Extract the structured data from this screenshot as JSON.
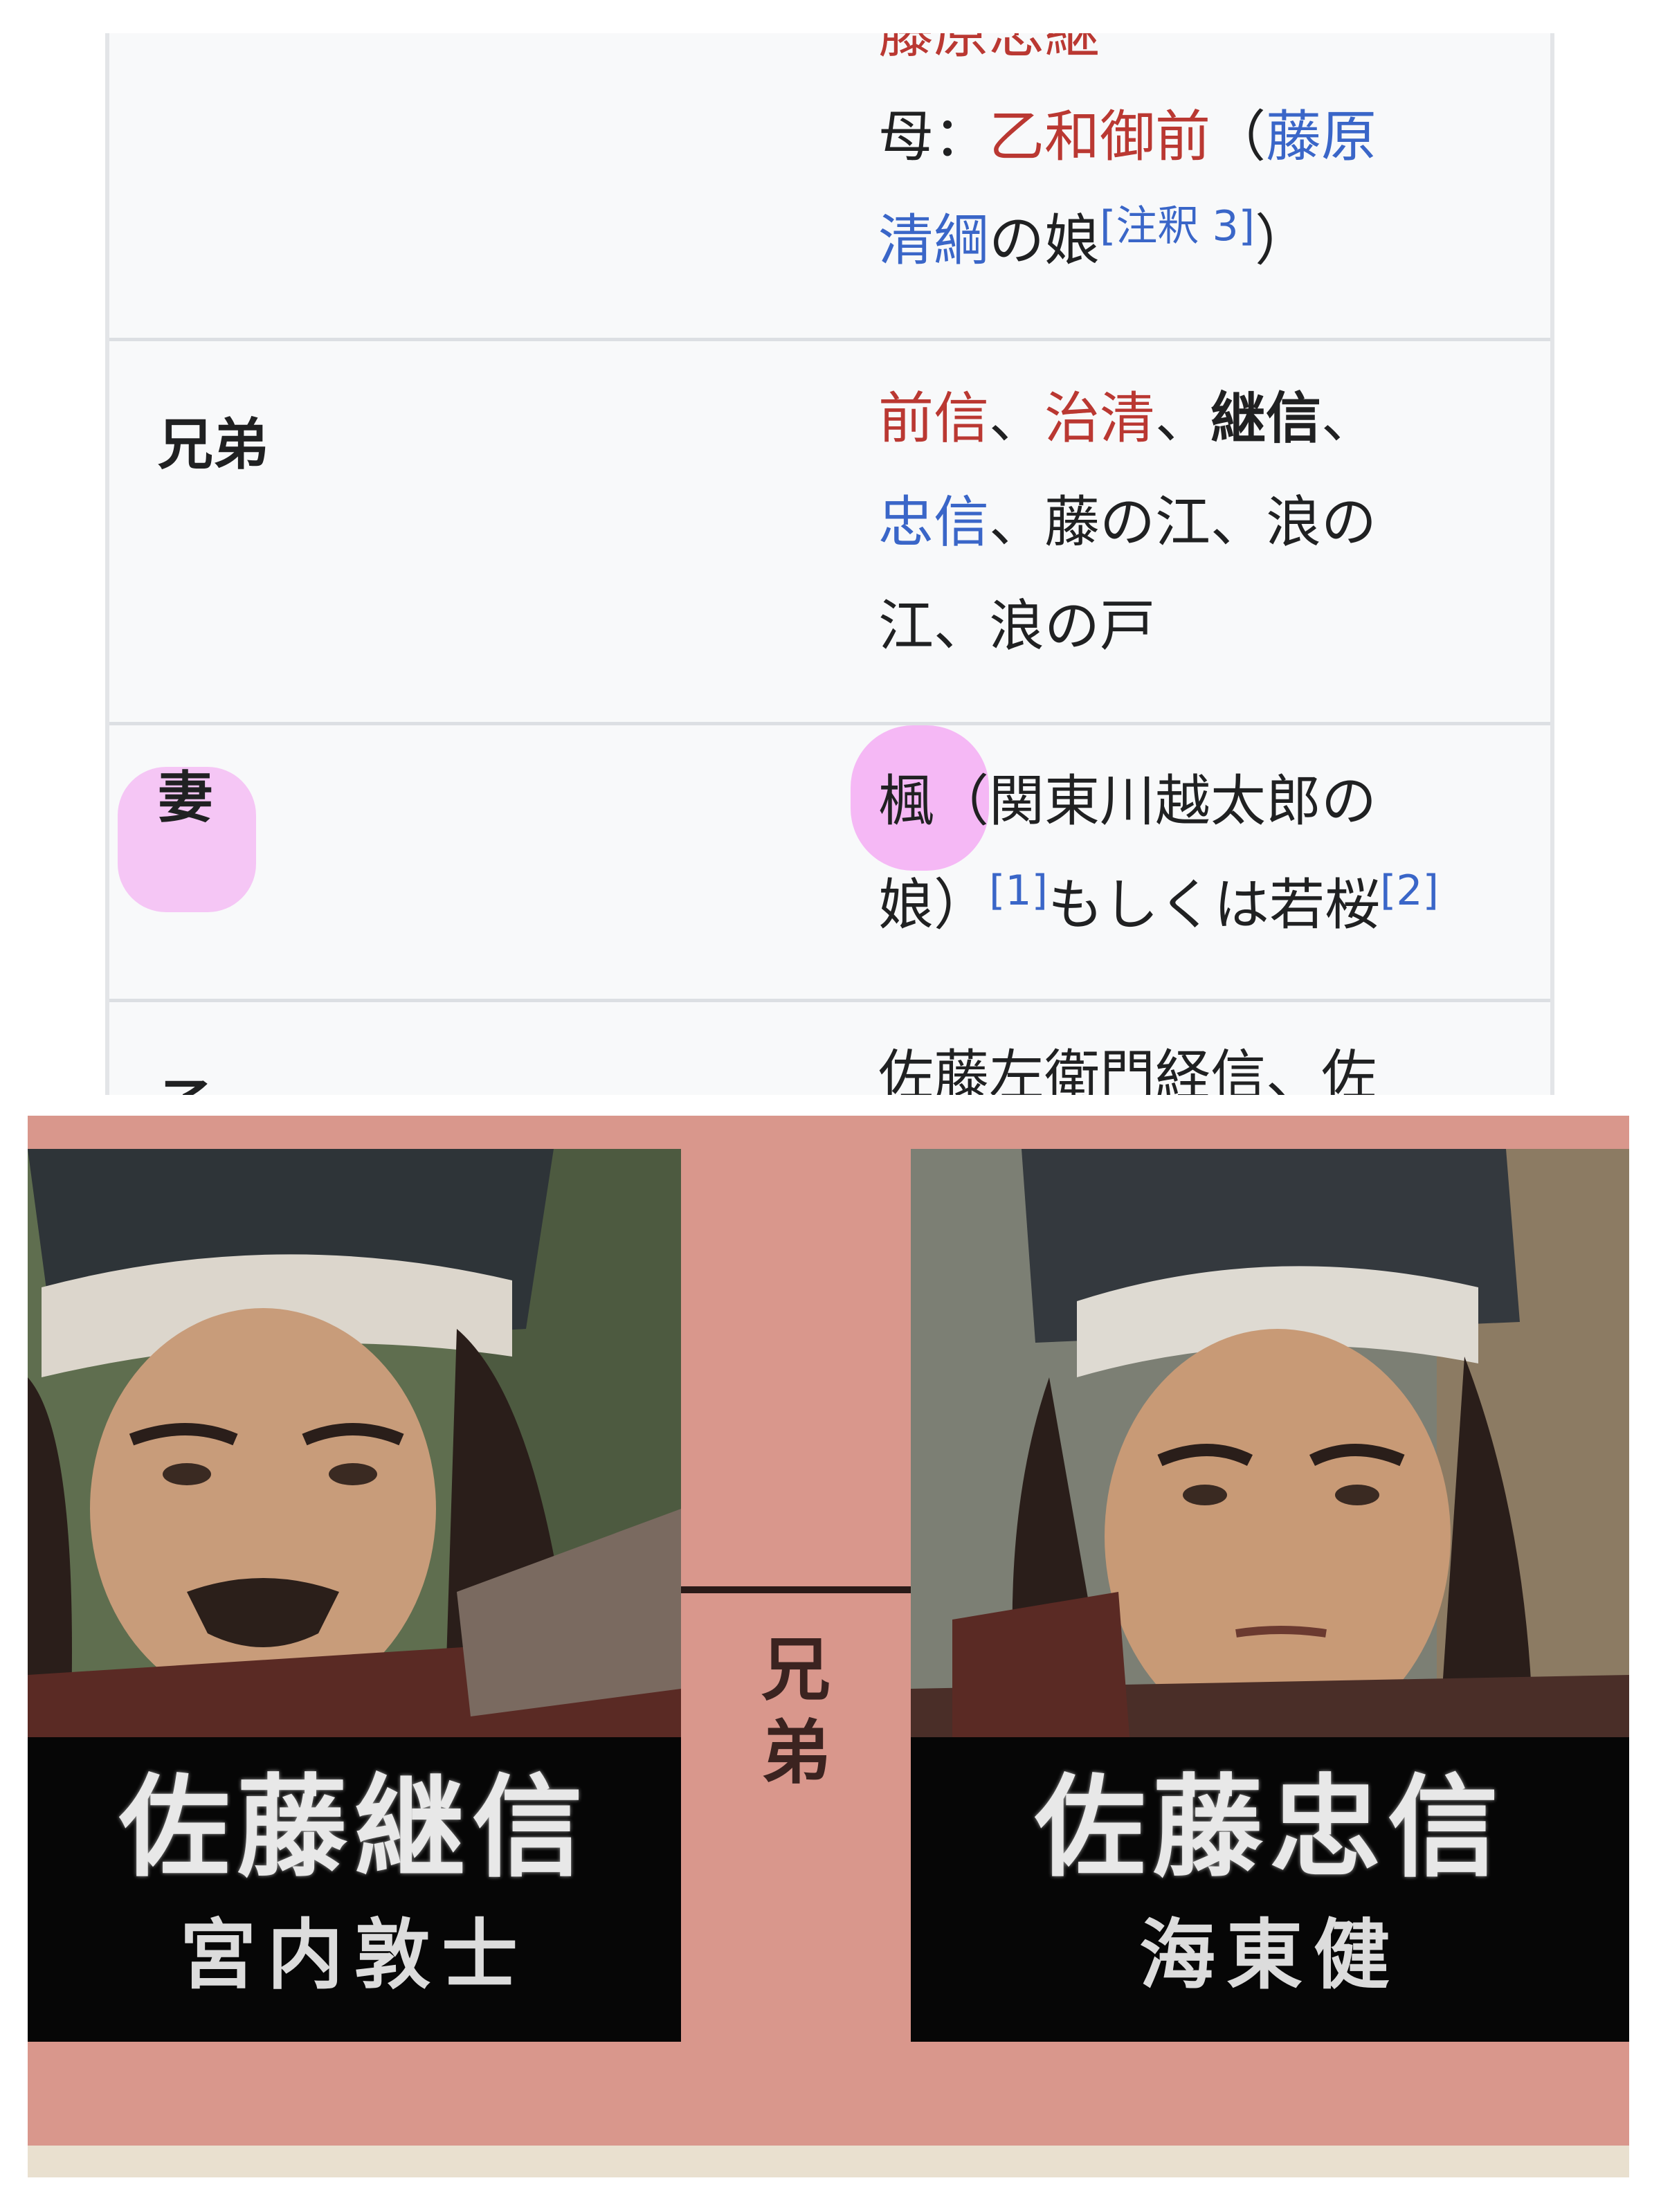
{
  "infobox": {
    "partial_top_line": [
      {
        "text": "藤原忠継",
        "color": "red"
      }
    ],
    "mother_row": {
      "line1": [
        {
          "text": "母：",
          "color": "plain"
        },
        {
          "text": "乙和御前",
          "color": "red"
        },
        {
          "text": "（",
          "color": "plain"
        },
        {
          "text": "藤原",
          "color": "blue"
        }
      ],
      "line2": [
        {
          "text": "清綱",
          "color": "blue"
        },
        {
          "text": "の娘",
          "color": "plain"
        }
      ],
      "ref": "[注釈 3]",
      "close": "）"
    },
    "siblings": {
      "label": "兄弟",
      "line1": [
        {
          "text": "前信",
          "color": "red"
        },
        {
          "text": "、",
          "color": "plain"
        },
        {
          "text": "治清",
          "color": "red"
        },
        {
          "text": "、",
          "color": "plain"
        },
        {
          "text": "継信",
          "color": "bold"
        },
        {
          "text": "、",
          "color": "plain"
        }
      ],
      "line2": [
        {
          "text": "忠信",
          "color": "blue"
        },
        {
          "text": "、藤の江、浪の",
          "color": "plain"
        }
      ],
      "line3": [
        {
          "text": "江、浪の戸",
          "color": "plain"
        }
      ]
    },
    "wife": {
      "label": "妻",
      "line1": [
        {
          "text": "楓",
          "color": "plain"
        },
        {
          "text": "（関東川越太郎の",
          "color": "plain"
        }
      ],
      "line2_a": "娘）",
      "ref1": "[1]",
      "line2_b": "もしくは若桜",
      "ref2": "[2]"
    },
    "children": {
      "label": "子",
      "line1": "佐藤左衛門経信、佐"
    }
  },
  "cast_card": {
    "relation_label": "兄弟",
    "left": {
      "character": "佐藤継信",
      "actor": "宮内敦士"
    },
    "right": {
      "character": "佐藤忠信",
      "actor": "海東健"
    }
  },
  "colors": {
    "link_red": "#ba3832",
    "link_blue": "#3a66c8",
    "highlight": "#f5c6f5",
    "card_bg": "#d9978c"
  }
}
